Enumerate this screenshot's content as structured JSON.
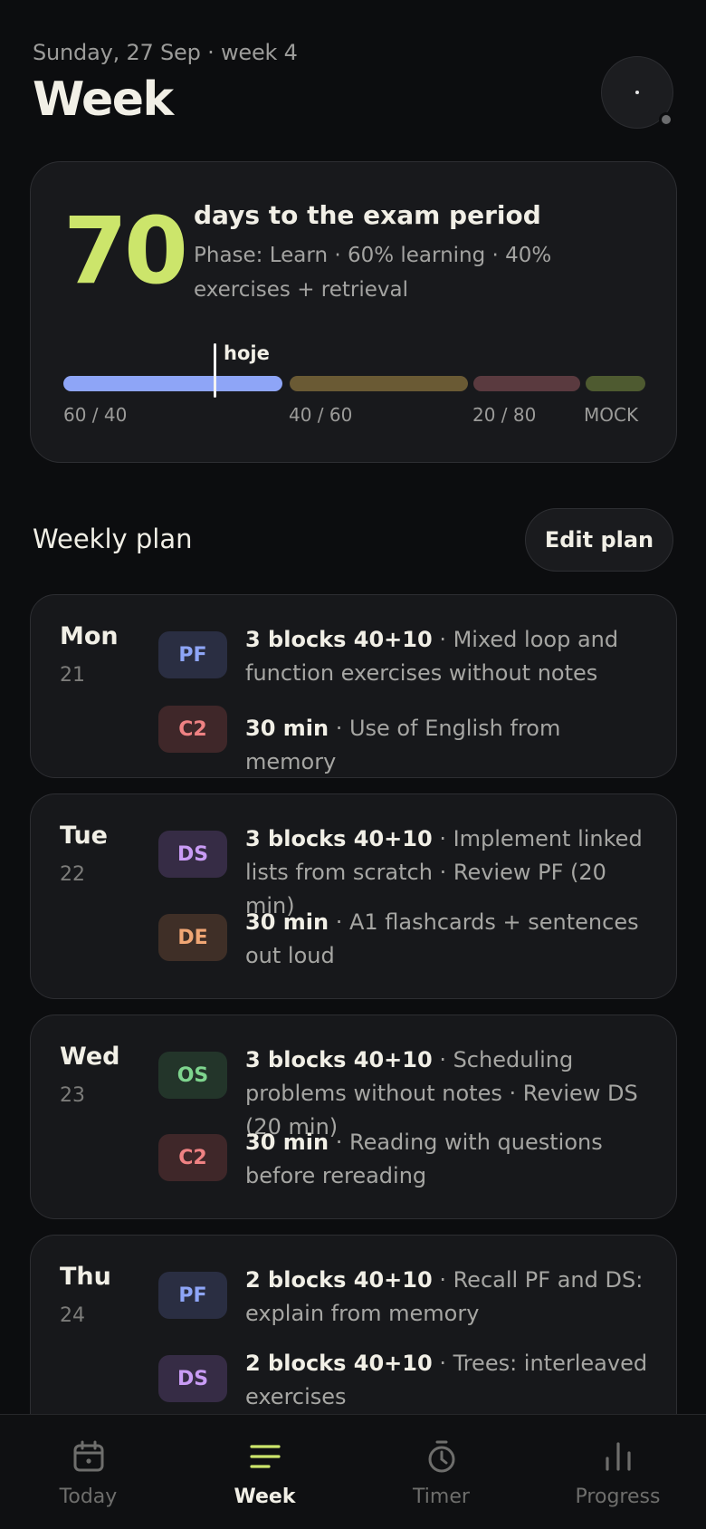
{
  "header": {
    "date": "Sunday, 27 Sep · week 4",
    "title": "Week"
  },
  "exam": {
    "days": "70",
    "title": "days to the exam period",
    "phase": "Phase: Learn · 60% learning · 40% exercises + retrieval",
    "today_label": "hoje",
    "segments": [
      "60 / 40",
      "40 / 60",
      "20 / 80",
      "MOCK"
    ]
  },
  "plan": {
    "title": "Weekly plan",
    "edit_label": "Edit plan",
    "days": [
      {
        "name": "Mon",
        "num": "21",
        "tasks": [
          {
            "badge": "PF",
            "bold": "3 blocks 40+10",
            "text": " · Mixed loop and function exercises without notes"
          },
          {
            "badge": "C2",
            "bold": "30 min",
            "text": " · Use of English from memory"
          }
        ]
      },
      {
        "name": "Tue",
        "num": "22",
        "tasks": [
          {
            "badge": "DS",
            "bold": "3 blocks 40+10",
            "text": " · Implement linked lists from scratch · Review PF (20 min)"
          },
          {
            "badge": "DE",
            "bold": "30 min",
            "text": " · A1 flashcards + sentences out loud"
          }
        ]
      },
      {
        "name": "Wed",
        "num": "23",
        "tasks": [
          {
            "badge": "OS",
            "bold": "3 blocks 40+10",
            "text": " · Scheduling problems without notes · Review DS (20 min)"
          },
          {
            "badge": "C2",
            "bold": "30 min",
            "text": " · Reading with questions before rereading"
          }
        ]
      },
      {
        "name": "Thu",
        "num": "24",
        "tasks": [
          {
            "badge": "PF",
            "bold": "2 blocks 40+10",
            "text": " · Recall PF and DS: explain from memory"
          },
          {
            "badge": "DS",
            "bold": "2 blocks 40+10",
            "text": " · Trees: interleaved exercises"
          }
        ]
      }
    ]
  },
  "tabs": [
    {
      "label": "Today",
      "icon": "calendar-icon"
    },
    {
      "label": "Week",
      "icon": "menu-lines-icon"
    },
    {
      "label": "Timer",
      "icon": "stopwatch-icon"
    },
    {
      "label": "Progress",
      "icon": "bar-chart-icon"
    }
  ],
  "colors": {
    "accent": "#cce56b",
    "pf": "#8ea5f7",
    "c2": "#ef8283",
    "ds": "#c99cf5",
    "de": "#f0a674",
    "os": "#7ed58e"
  }
}
